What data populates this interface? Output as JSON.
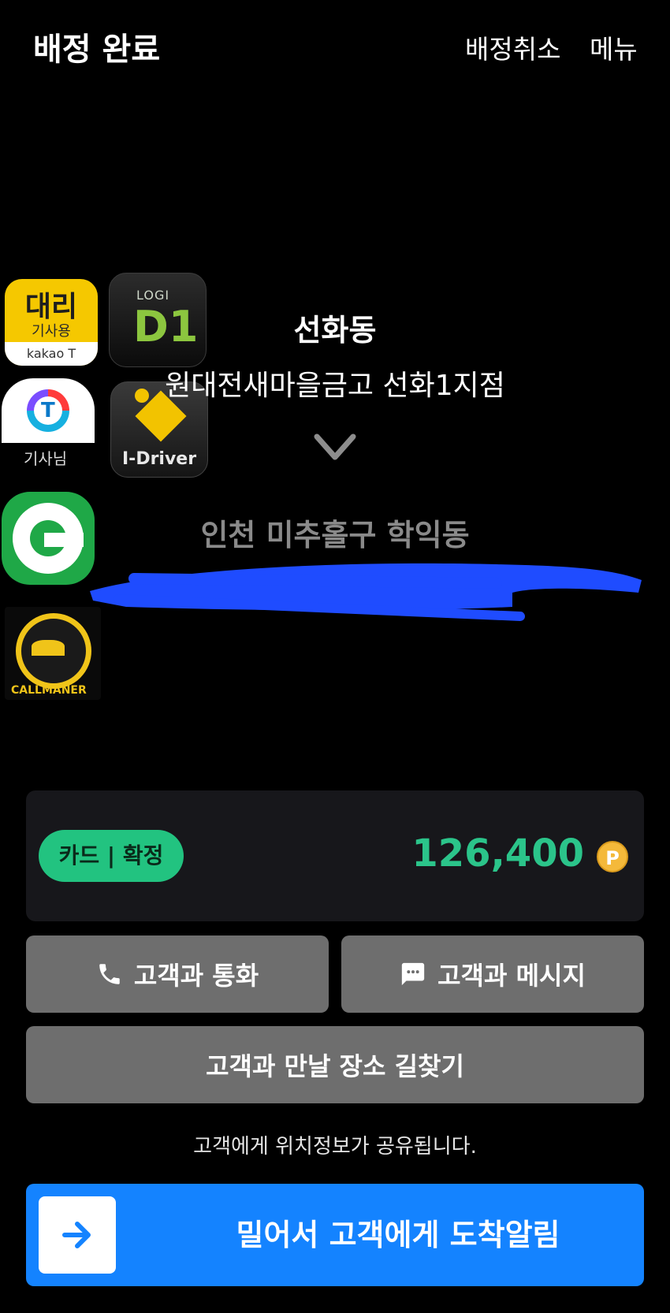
{
  "header": {
    "title": "배정 완료",
    "cancel_label": "배정취소",
    "menu_label": "메뉴"
  },
  "apps": {
    "kakao": {
      "big": "대리",
      "sub": "기사용",
      "foot": "kakao T"
    },
    "logi": {
      "small": "LOGI",
      "big": "D1"
    },
    "tmap": {
      "glyph": "T",
      "label": "기사님"
    },
    "idriver": {
      "name": "I-Driver"
    },
    "callmaner": {
      "name": "CALLMANER"
    }
  },
  "route": {
    "origin_name": "선화동",
    "origin_address": "원대전새마을금고 선화1지점",
    "destination_name": "인천 미추홀구 학익동"
  },
  "fare": {
    "payment_badge": "카드 | 확정",
    "amount": "126,400",
    "coin_symbol": "P"
  },
  "actions": {
    "call_label": "고객과 통화",
    "message_label": "고객과 메시지",
    "navigate_label": "고객과 만날 장소 길찾기"
  },
  "notice": "고객에게 위치정보가 공유됩니다.",
  "slide": {
    "label": "밀어서 고객에게 도착알림"
  },
  "colors": {
    "fare_green": "#2bc48a",
    "badge_green": "#22c380",
    "slide_blue": "#1483ff",
    "button_gray": "#6e6e6e",
    "redaction_blue": "#1f4cff"
  }
}
